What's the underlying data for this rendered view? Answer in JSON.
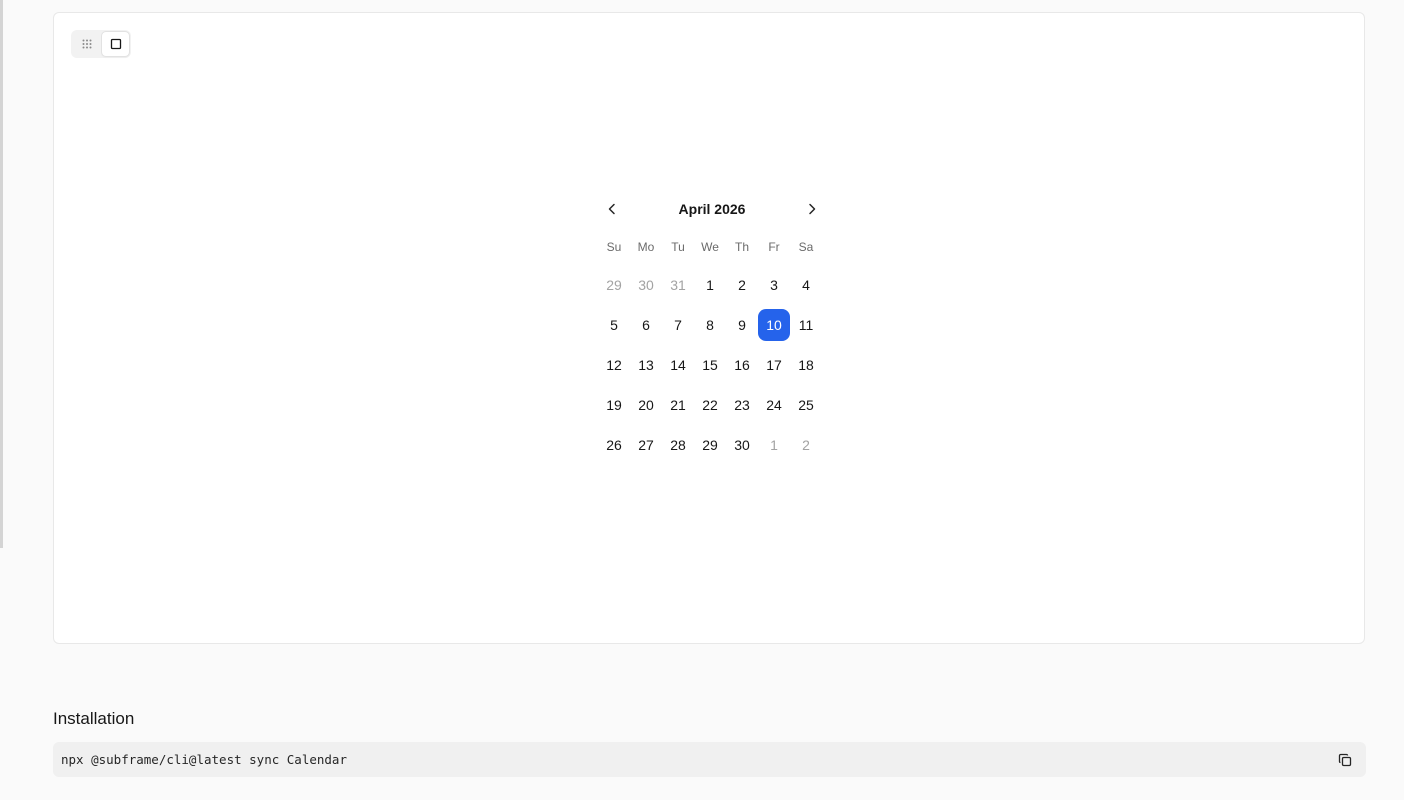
{
  "calendar": {
    "month_label": "April 2026",
    "weekdays": [
      "Su",
      "Mo",
      "Tu",
      "We",
      "Th",
      "Fr",
      "Sa"
    ],
    "weeks": [
      [
        {
          "label": "29",
          "outside": true
        },
        {
          "label": "30",
          "outside": true
        },
        {
          "label": "31",
          "outside": true
        },
        {
          "label": "1"
        },
        {
          "label": "2"
        },
        {
          "label": "3"
        },
        {
          "label": "4"
        }
      ],
      [
        {
          "label": "5"
        },
        {
          "label": "6"
        },
        {
          "label": "7"
        },
        {
          "label": "8"
        },
        {
          "label": "9"
        },
        {
          "label": "10",
          "selected": true
        },
        {
          "label": "11"
        }
      ],
      [
        {
          "label": "12"
        },
        {
          "label": "13"
        },
        {
          "label": "14"
        },
        {
          "label": "15"
        },
        {
          "label": "16"
        },
        {
          "label": "17"
        },
        {
          "label": "18"
        }
      ],
      [
        {
          "label": "19"
        },
        {
          "label": "20"
        },
        {
          "label": "21"
        },
        {
          "label": "22"
        },
        {
          "label": "23"
        },
        {
          "label": "24"
        },
        {
          "label": "25"
        }
      ],
      [
        {
          "label": "26"
        },
        {
          "label": "27"
        },
        {
          "label": "28"
        },
        {
          "label": "29"
        },
        {
          "label": "30"
        },
        {
          "label": "1",
          "outside": true
        },
        {
          "label": "2",
          "outside": true
        }
      ]
    ],
    "selected_color": "#2563eb"
  },
  "view_toggle": {
    "options": [
      "grid-icon",
      "square-icon"
    ],
    "active": "square-icon"
  },
  "installation": {
    "title": "Installation",
    "command": "npx @subframe/cli@latest sync Calendar",
    "copy_icon": "copy-icon"
  }
}
